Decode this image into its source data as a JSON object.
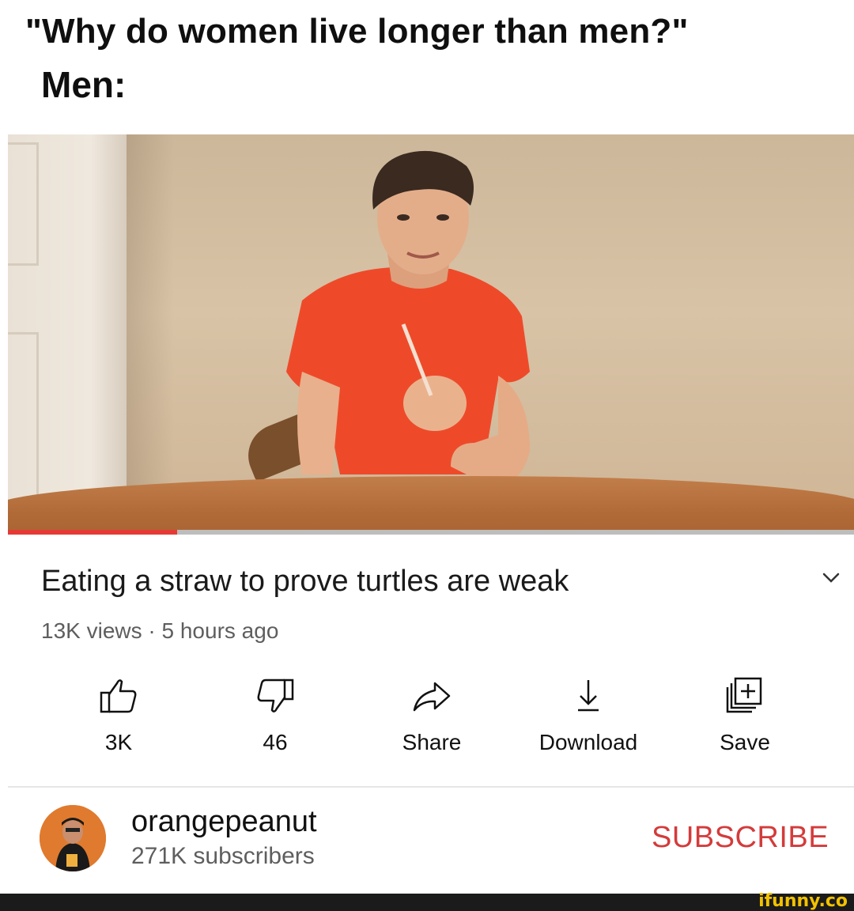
{
  "meme": {
    "caption_line1": "\"Why do women live longer than men?\"",
    "caption_line2": "Men:"
  },
  "player": {
    "progress_fraction": 0.2,
    "progress_color": "#e53935"
  },
  "video": {
    "title": "Eating a straw to prove turtles are weak",
    "meta": "13K views · 5 hours ago",
    "actions": [
      {
        "icon": "thumbs-up-icon",
        "label": "3K"
      },
      {
        "icon": "thumbs-down-icon",
        "label": "46"
      },
      {
        "icon": "share-icon",
        "label": "Share"
      },
      {
        "icon": "download-icon",
        "label": "Download"
      },
      {
        "icon": "save-playlist-icon",
        "label": "Save"
      }
    ]
  },
  "channel": {
    "name": "orangepeanut",
    "subscribers": "271K subscribers",
    "subscribe_label": "SUBSCRIBE",
    "subscribe_color": "#d43b3b"
  },
  "watermark": {
    "text": "ifunny.co"
  }
}
